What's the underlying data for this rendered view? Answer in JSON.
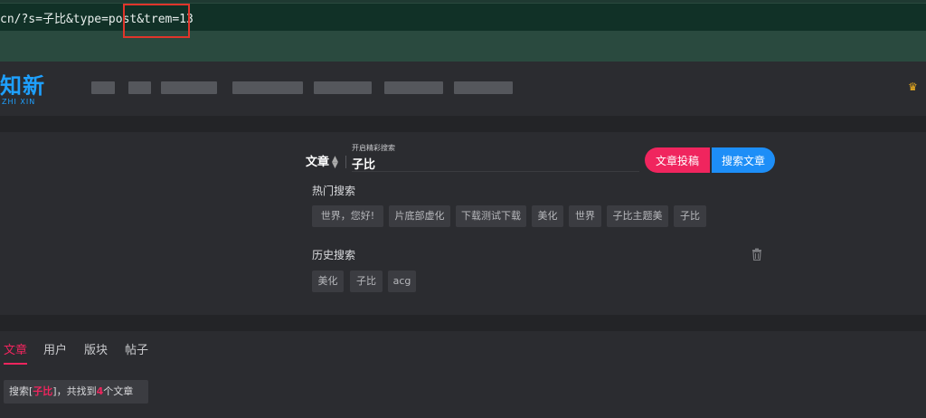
{
  "browser": {
    "url_text": "cn/?s=子比&type=post&trem=13"
  },
  "header": {
    "logo_text": "知新",
    "logo_sub": "ZHI XIN"
  },
  "search": {
    "type_label": "文章",
    "hint": "开启精彩搜索",
    "query": "子比",
    "submit_label": "文章投稿",
    "search_label": "搜索文章",
    "hot_title": "热门搜索",
    "hot_tags": [
      "世界，您好!",
      "片底部虚化",
      "下载测试下载",
      "美化",
      "世界",
      "子比主题美",
      "子比"
    ],
    "history_title": "历史搜索",
    "history_tags": [
      "美化",
      "子比",
      "acg"
    ]
  },
  "tabs": {
    "items": [
      "文章",
      "用户",
      "版块",
      "帖子"
    ],
    "active": "文章"
  },
  "result": {
    "prefix": "搜索[",
    "keyword": "子比",
    "middle": "]，共找到",
    "count": "4",
    "suffix": "个文章"
  },
  "colors": {
    "accent_pink": "#f0255e",
    "accent_blue": "#1d8ef7",
    "logo_blue": "#1ea0ff"
  }
}
